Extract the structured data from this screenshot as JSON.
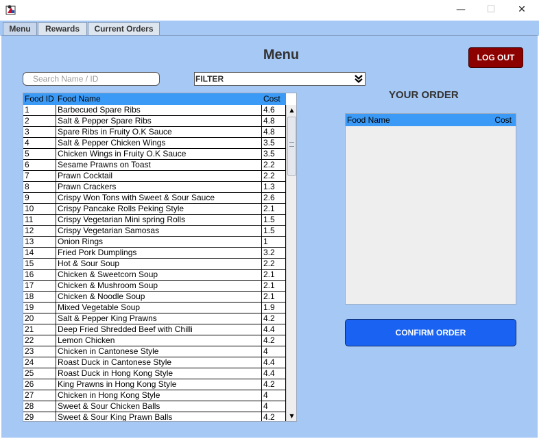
{
  "window": {
    "minimize_glyph": "—",
    "maximize_glyph": "☐",
    "close_glyph": "✕"
  },
  "tabs": [
    "Menu",
    "Rewards",
    "Current Orders"
  ],
  "menu": {
    "title": "Menu",
    "logout_label": "LOG OUT",
    "search_placeholder": "Search Name / ID",
    "search_value": "",
    "filter_value": "FILTER",
    "columns": [
      "Food ID",
      "Food Name",
      "Cost"
    ],
    "rows": [
      [
        "1",
        "Barbecued Spare Ribs",
        "4.6"
      ],
      [
        "2",
        "Salt & Pepper Spare Ribs",
        "4.8"
      ],
      [
        "3",
        "Spare Ribs in Fruity O.K Sauce",
        "4.8"
      ],
      [
        "4",
        "Salt & Pepper Chicken Wings",
        "3.5"
      ],
      [
        "5",
        "Chicken Wings in Fruity O.K Sauce",
        "3.5"
      ],
      [
        "6",
        "Sesame Prawns on Toast",
        "2.2"
      ],
      [
        "7",
        "Prawn Cocktail",
        "2.2"
      ],
      [
        "8",
        "Prawn Crackers",
        "1.3"
      ],
      [
        "9",
        "Crispy Won Tons with Sweet & Sour Sauce",
        "2.6"
      ],
      [
        "10",
        "Crispy Pancake Rolls Peking Style",
        "2.1"
      ],
      [
        "11",
        "Crispy Vegetarian Mini spring Rolls",
        "1.5"
      ],
      [
        "12",
        "Crispy Vegetarian Samosas",
        "1.5"
      ],
      [
        "13",
        "Onion Rings",
        "1"
      ],
      [
        "14",
        "Fried Pork Dumplings",
        "3.2"
      ],
      [
        "15",
        "Hot & Sour Soup",
        "2.2"
      ],
      [
        "16",
        "Chicken & Sweetcorn Soup",
        "2.1"
      ],
      [
        "17",
        "Chicken & Mushroom Soup",
        "2.1"
      ],
      [
        "18",
        "Chicken & Noodle Soup",
        "2.1"
      ],
      [
        "19",
        "Mixed Vegetable Soup",
        "1.9"
      ],
      [
        "20",
        "Salt & Pepper King Prawns",
        "4.2"
      ],
      [
        "21",
        "Deep Fried Shredded Beef with Chilli",
        "4.4"
      ],
      [
        "22",
        "Lemon Chicken",
        "4.2"
      ],
      [
        "23",
        "Chicken in Cantonese Style",
        "4"
      ],
      [
        "24",
        "Roast Duck in Cantonese Style",
        "4.4"
      ],
      [
        "25",
        "Roast Duck in Hong Kong Style",
        "4.4"
      ],
      [
        "26",
        "King Prawns in Hong Kong Style",
        "4.2"
      ],
      [
        "27",
        "Chicken in Hong Kong Style",
        "4"
      ],
      [
        "28",
        "Sweet & Sour Chicken Balls",
        "4"
      ],
      [
        "29",
        "Sweet & Sour King Prawn Balls",
        "4.2"
      ]
    ]
  },
  "order": {
    "title": "YOUR ORDER",
    "columns": [
      "Food Name",
      "Cost"
    ],
    "confirm_label": "CONFIRM ORDER"
  },
  "colors": {
    "panel_bg": "#a6c8f5",
    "table_header": "#3b9af6",
    "logout_bg": "#8d0000",
    "confirm_bg": "#1a63f2"
  }
}
